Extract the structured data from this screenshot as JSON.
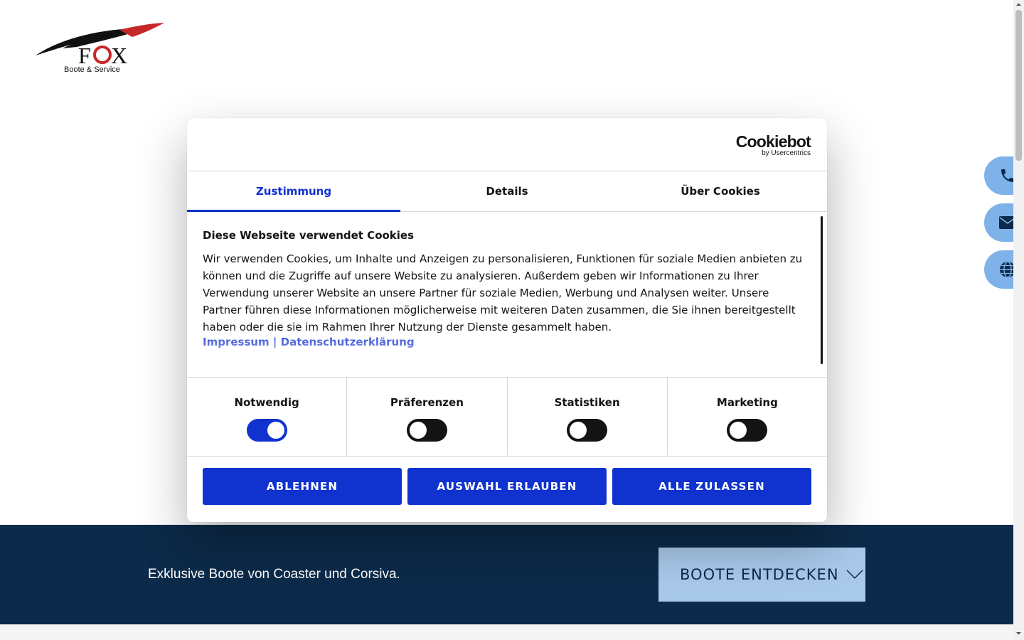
{
  "logo": {
    "text": "FOX",
    "tagline": "Boote & Service"
  },
  "dialog": {
    "brand": "Cookiebot",
    "brand_sub": "by Usercentrics",
    "tabs": [
      {
        "label": "Zustimmung",
        "active": true
      },
      {
        "label": "Details",
        "active": false
      },
      {
        "label": "Über Cookies",
        "active": false
      }
    ],
    "heading": "Diese Webseite verwendet Cookies",
    "body": "Wir verwenden Cookies, um Inhalte und Anzeigen zu personalisieren, Funktionen für soziale Medien anbieten zu können und die Zugriffe auf unsere Website zu analysieren. Außerdem geben wir Informationen zu Ihrer Verwendung unserer Website an unsere Partner für soziale Medien, Werbung und Analysen weiter. Unsere Partner führen diese Informationen möglicherweise mit weiteren Daten zusammen, die Sie ihnen bereitgestellt haben oder die sie im Rahmen Ihrer Nutzung der Dienste gesammelt haben.",
    "link_impressum": "Impressum",
    "link_separator": "|",
    "link_privacy": "Datenschutzerklärung",
    "toggles": [
      {
        "label": "Notwendig",
        "on": true
      },
      {
        "label": "Präferenzen",
        "on": false
      },
      {
        "label": "Statistiken",
        "on": false
      },
      {
        "label": "Marketing",
        "on": false
      }
    ],
    "buttons": {
      "reject": "ABLEHNEN",
      "allow_selection": "AUSWAHL ERLAUBEN",
      "allow_all": "ALLE ZULASSEN"
    }
  },
  "band": {
    "text": "Exklusive Boote von Coaster und Corsiva.",
    "cta": "BOOTE ENTDECKEN"
  },
  "side_buttons": [
    "phone-icon",
    "envelope-icon",
    "globe-icon"
  ],
  "colors": {
    "accent": "#1032cf",
    "band_bg": "#0c2b4a",
    "cta_bg": "#a9c9eb",
    "side_btn": "#7fb2e8"
  }
}
